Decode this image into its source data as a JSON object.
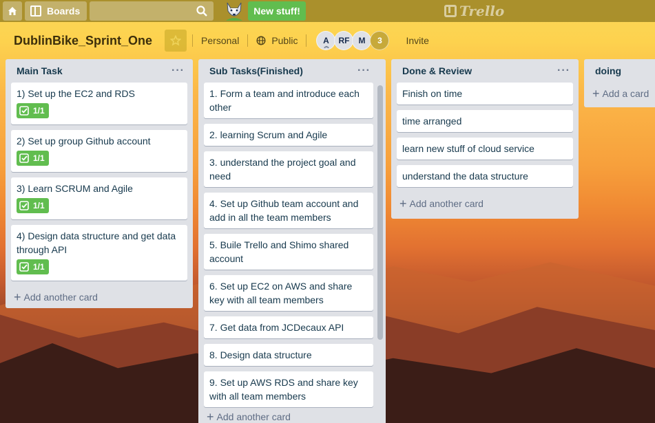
{
  "header": {
    "boards_label": "Boards",
    "search_placeholder": "",
    "new_stuff_label": "New stuff!",
    "logo_text": "Trello"
  },
  "board": {
    "title": "DublinBike_Sprint_One",
    "team_label": "Personal",
    "visibility_label": "Public",
    "members": [
      "A",
      "RF",
      "M"
    ],
    "member_overflow": "3",
    "invite_label": "Invite"
  },
  "lists": [
    {
      "title": "Main Task",
      "cards": [
        {
          "text": "1) Set up the EC2 and RDS",
          "badge": "1/1"
        },
        {
          "text": "2) Set up group Github account",
          "badge": "1/1"
        },
        {
          "text": "3) Learn SCRUM and Agile",
          "badge": "1/1"
        },
        {
          "text": "4) Design data structure and get data through API",
          "badge": "1/1"
        }
      ],
      "add_label": "Add another card"
    },
    {
      "title": "Sub Tasks(Finished)",
      "cards": [
        {
          "text": "1. Form a team and introduce each other"
        },
        {
          "text": "2. learning Scrum and Agile"
        },
        {
          "text": "3. understand the project goal and need"
        },
        {
          "text": "4. Set up Github team account and add in all the team members"
        },
        {
          "text": "5. Buile Trello and Shimo shared account"
        },
        {
          "text": "6. Set up EC2 on AWS and share key with all team members"
        },
        {
          "text": "7. Get data from JCDecaux API"
        },
        {
          "text": "8. Design data structure"
        },
        {
          "text": "9. Set up AWS RDS and share key with all team members"
        }
      ],
      "add_label": "Add another card"
    },
    {
      "title": "Done & Review",
      "cards": [
        {
          "text": "Finish on time"
        },
        {
          "text": "time arranged"
        },
        {
          "text": "learn new stuff of cloud service"
        },
        {
          "text": "understand the data structure"
        }
      ],
      "add_label": "Add another card"
    },
    {
      "title": "doing",
      "cards": [],
      "add_label": "Add a card"
    }
  ],
  "colors": {
    "header_bg": "#a38a28",
    "badge_green": "#61bd4f",
    "list_bg": "#dfe1e6"
  }
}
